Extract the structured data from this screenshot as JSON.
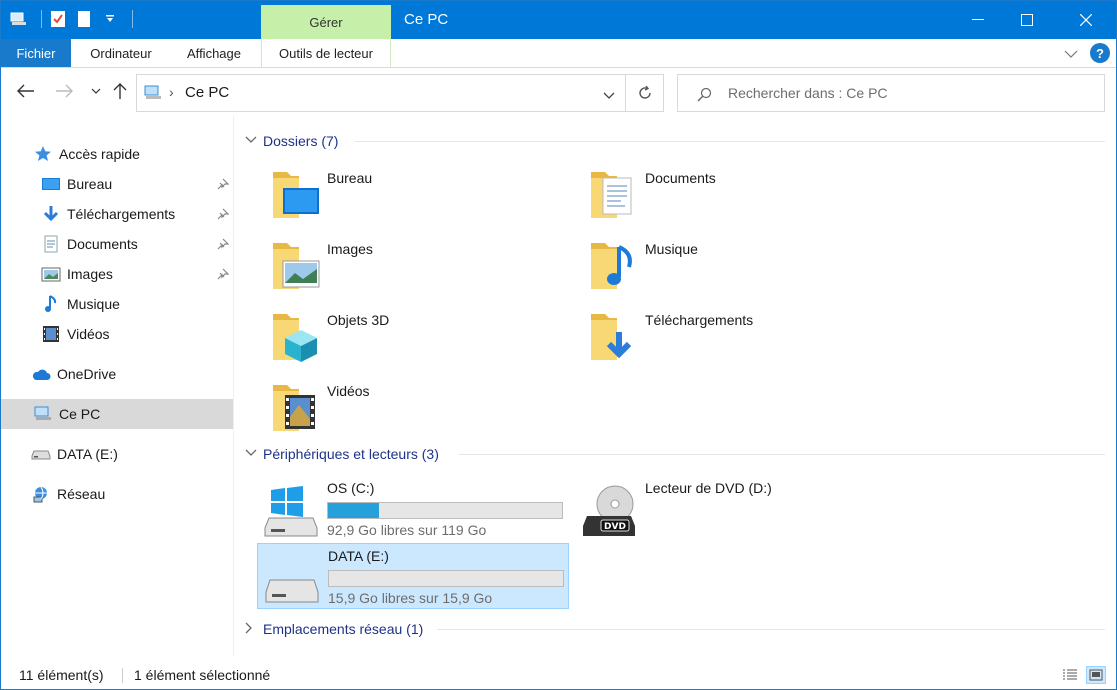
{
  "window": {
    "title": "Ce PC",
    "manage_tab": "Gérer",
    "accent": "#0078d7"
  },
  "ribbon": {
    "tabs": [
      "Fichier",
      "Ordinateur",
      "Affichage",
      "Outils de lecteur"
    ]
  },
  "address": {
    "path": "Ce PC",
    "search_placeholder": "Rechercher dans : Ce PC"
  },
  "sidebar": {
    "items": [
      {
        "label": "Accès rapide",
        "icon": "star-icon"
      },
      {
        "label": "Bureau",
        "icon": "desktop-icon",
        "pinned": true
      },
      {
        "label": "Téléchargements",
        "icon": "download-icon",
        "pinned": true
      },
      {
        "label": "Documents",
        "icon": "document-icon",
        "pinned": true
      },
      {
        "label": "Images",
        "icon": "image-icon",
        "pinned": true
      },
      {
        "label": "Musique",
        "icon": "music-icon"
      },
      {
        "label": "Vidéos",
        "icon": "video-icon"
      },
      {
        "label": "OneDrive",
        "icon": "cloud-icon"
      },
      {
        "label": "Ce PC",
        "icon": "computer-icon",
        "selected": true
      },
      {
        "label": "DATA (E:)",
        "icon": "drive-icon"
      },
      {
        "label": "Réseau",
        "icon": "network-icon"
      }
    ]
  },
  "main": {
    "folders_header": "Dossiers (7)",
    "folders": [
      {
        "label": "Bureau",
        "icon": "desktop-folder-icon"
      },
      {
        "label": "Documents",
        "icon": "documents-folder-icon"
      },
      {
        "label": "Images",
        "icon": "images-folder-icon"
      },
      {
        "label": "Musique",
        "icon": "music-folder-icon"
      },
      {
        "label": "Objets 3D",
        "icon": "3d-objects-folder-icon"
      },
      {
        "label": "Téléchargements",
        "icon": "downloads-folder-icon"
      },
      {
        "label": "Vidéos",
        "icon": "videos-folder-icon"
      }
    ],
    "devices_header": "Périphériques et lecteurs (3)",
    "drives": [
      {
        "name": "OS (C:)",
        "free": "92,9 Go libres sur 119 Go",
        "used_fraction": 0.22,
        "icon": "windows-drive-icon"
      },
      {
        "name": "Lecteur de DVD (D:)",
        "icon": "dvd-drive-icon"
      },
      {
        "name": "DATA (E:)",
        "free": "15,9 Go libres sur 15,9 Go",
        "used_fraction": 0.0,
        "icon": "hard-drive-icon",
        "selected": true
      }
    ],
    "network_header": "Emplacements réseau (1)"
  },
  "status": {
    "count": "11 élément(s)",
    "selection": "1 élément sélectionné"
  }
}
